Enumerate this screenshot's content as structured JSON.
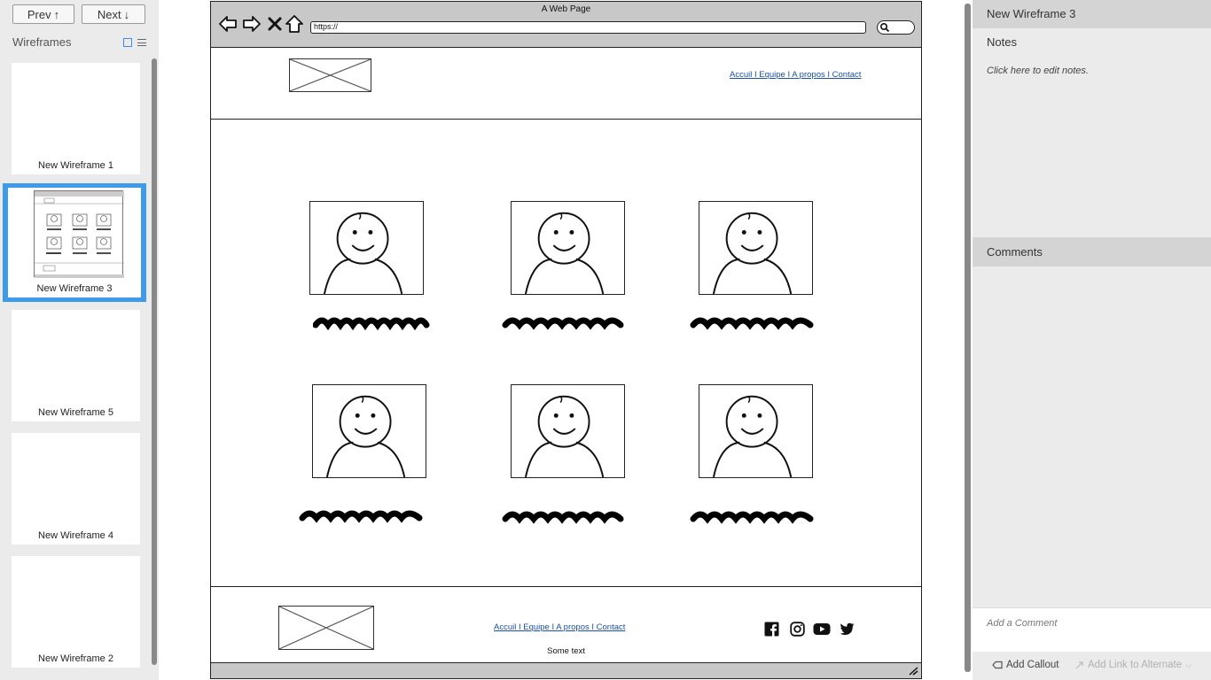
{
  "left_panel": {
    "prev_label": "Prev",
    "next_label": "Next",
    "title": "Wireframes",
    "thumbnails": [
      {
        "label": "New Wireframe 1",
        "selected": false
      },
      {
        "label": "New Wireframe 3",
        "selected": true
      },
      {
        "label": "New Wireframe 5",
        "selected": false
      },
      {
        "label": "New Wireframe 4",
        "selected": false
      },
      {
        "label": "New Wireframe 2",
        "selected": false
      }
    ]
  },
  "mockup": {
    "browser_title": "A Web Page",
    "url": "https://",
    "header_links": "Accuil I  Equipe I A propos I Contact",
    "footer_links": "Accuil I  Equipe I A propos I Contact",
    "footer_text": "Some text",
    "social_icons": [
      "facebook-icon",
      "instagram-icon",
      "youtube-icon",
      "twitter-icon"
    ]
  },
  "right_panel": {
    "wireframe_name": "New Wireframe 3",
    "notes_heading": "Notes",
    "notes_placeholder": "Click here to edit notes.",
    "comments_heading": "Comments",
    "comment_placeholder": "Add a Comment",
    "add_callout_label": "Add Callout",
    "add_link_label": "Add Link to Alternate"
  },
  "colors": {
    "selection": "#3d9be9",
    "link": "#1a4fa6",
    "panel_bg": "#ebebeb"
  }
}
